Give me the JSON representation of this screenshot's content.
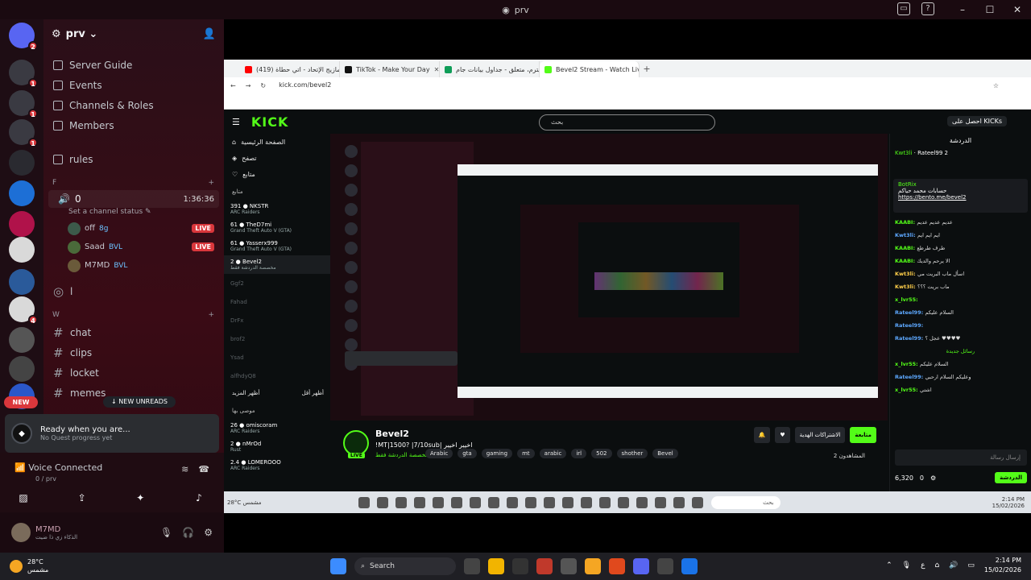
{
  "window": {
    "title": "prv"
  },
  "rail": {
    "servers": [
      {
        "icon": "discord-icon",
        "badge": "2",
        "color": "#5865f2"
      },
      {
        "icon": "server-icon",
        "badge": "1",
        "color": "#3a3a42"
      },
      {
        "icon": "server-icon",
        "badge": "1",
        "color": "#3a3a42"
      },
      {
        "icon": "server-icon",
        "badge": "1",
        "color": "#3a3a42"
      },
      {
        "icon": "server-icon",
        "badge": "",
        "color": "#2a2a30"
      },
      {
        "icon": "server-icon",
        "badge": "",
        "color": "#1d6fd6"
      },
      {
        "icon": "server-icon",
        "badge": "",
        "color": "#b0124a"
      },
      {
        "icon": "server-icon",
        "badge": "",
        "color": "#d9d9d9"
      },
      {
        "icon": "server-icon",
        "badge": "",
        "color": "#2a5a9a"
      },
      {
        "icon": "server-icon",
        "badge": "4",
        "color": "#d9d9d9"
      },
      {
        "icon": "server-icon",
        "badge": "",
        "color": "#555"
      },
      {
        "icon": "server-icon",
        "badge": "",
        "color": "#444"
      },
      {
        "icon": "server-icon",
        "badge": "",
        "color": "#2b57c9"
      }
    ],
    "new_label": "NEW"
  },
  "sidebar": {
    "server_name": "prv",
    "nav": [
      "Server Guide",
      "Events",
      "Channels & Roles",
      "Members"
    ],
    "rules": "rules",
    "cat_f": "F",
    "voice_channel": {
      "name": "0",
      "time": "1:36:36",
      "status": "Set a channel status"
    },
    "voice_users": [
      {
        "name": "off",
        "tag": "8g",
        "live": "LIVE"
      },
      {
        "name": "Saad",
        "tag": "BVL",
        "live": "LIVE"
      },
      {
        "name": "M7MD",
        "tag": "BVL",
        "live": ""
      }
    ],
    "voice_channel_2": "l",
    "cat_w": "W",
    "channels": [
      "chat",
      "clips",
      "locket",
      "memes"
    ],
    "new_unreads": "NEW UNREADS",
    "quest": {
      "title": "Ready when you are...",
      "sub": "No Quest progress yet"
    },
    "voice": {
      "status": "Voice Connected",
      "channel": "0 / prv"
    },
    "user": {
      "name": "M7MD",
      "status": "الذكاء زي ذا ضيت"
    }
  },
  "browser": {
    "tabs": [
      {
        "title": "(419) امازيج الإتحاد - اتي حطاة",
        "color": "#ff0000"
      },
      {
        "title": "TikTok - Make Your Day",
        "color": "#111"
      },
      {
        "title": "السيترم، متعلق - جداول بيانات جام",
        "color": "#0f9d58"
      },
      {
        "title": "Bevel2 Stream - Watch Live on",
        "color": "#53fc18"
      }
    ],
    "url": "kick.com/bevel2"
  },
  "kick": {
    "logo": "KICK",
    "search_placeholder": "بحث",
    "signup": "احصل على KICKs",
    "nav": [
      "الصفحة الرئيسية",
      "تصفح",
      "متابع"
    ],
    "section_following": "متابع",
    "streamers": [
      {
        "name": "391 ● NKSTR",
        "game": "ARC Raiders"
      },
      {
        "name": "61 ● TheD7mi",
        "game": "Grand Theft Auto V (GTA)"
      },
      {
        "name": "61 ● Yasserx999",
        "game": "Grand Theft Auto V (GTA)"
      },
      {
        "name": "2 ● Bevel2",
        "game": "مخصصة الدردشة فقط"
      }
    ],
    "offline": [
      "Ggf2",
      "Fahad",
      "DrFx",
      "brof2",
      "Ysad",
      "alfhdyQ8"
    ],
    "show_more": "أظهر المزيد",
    "show_less": "أظهر أقل",
    "section_recommended": "موصى بها",
    "recommended": [
      {
        "name": "26 ● omiscoram",
        "game": "ARC Raiders"
      },
      {
        "name": "2 ● nMrOd",
        "game": "Rust"
      },
      {
        "name": "2.4 ● LOMEROOO",
        "game": "ARC Raiders"
      }
    ],
    "stream": {
      "name": "Bevel2",
      "title": "!MT|1500? |7/10sub| اخيير اخيير",
      "category": "مخصصة الدردشة فقط",
      "tags": [
        "Arabic",
        "gta",
        "gaming",
        "mt",
        "arabic",
        "irl",
        "502",
        "shother",
        "Bevel"
      ],
      "live": "LIVE",
      "follow": "متابعة",
      "subscribe": "الاشتراكات الهدية",
      "viewers": "المشاهدون 2"
    },
    "chat": {
      "title": "الدردشة",
      "pinned_user": "Rateel99",
      "pinned_count": "2",
      "pinned_user2": "Kwt3li",
      "bot": "BotRix",
      "bot_text": "حسابات محمد حياكم",
      "bot_link": "https://bento.me/bevel2",
      "messages": [
        {
          "user": "KAABI",
          "text": "عديم عديم عديم",
          "c": "u"
        },
        {
          "user": "Kwt3li",
          "text": "ايم ايم ايم",
          "c": "u2"
        },
        {
          "user": "KAABI",
          "text": "طرف طرطع",
          "c": "u"
        },
        {
          "user": "KAABI",
          "text": "الا يرحم والديك",
          "c": "u"
        },
        {
          "user": "Kwt3li",
          "text": "اسأل ماب البريت مي",
          "c": "u3"
        },
        {
          "user": "Kwt3li",
          "text": "ماب بريت ؟؟؟",
          "c": "u3"
        },
        {
          "user": "x_lvr55",
          "text": "",
          "c": "u"
        },
        {
          "user": "Rateel99",
          "text": "السلام عليكم",
          "c": "u2"
        },
        {
          "user": "Rateel99",
          "text": "",
          "c": "u2"
        },
        {
          "user": "Rateel99",
          "text": "عجل ؟ ♥♥♥♥",
          "c": "u2"
        },
        {
          "user": "x_lvr55",
          "text": "السلام عليكم",
          "c": "u"
        },
        {
          "user": "Rateel99",
          "text": "وعليكم السلام ارحبي",
          "c": "u2"
        },
        {
          "user": "x_lvr55",
          "text": "اشتي",
          "c": "u"
        }
      ],
      "new_label": "رسائل جديدة",
      "input_placeholder": "إرسال رسالة",
      "points": "6,320",
      "count": "0",
      "send": "الدردشة"
    },
    "inner_taskbar": {
      "weather": "28°C مشمس",
      "search": "بحث",
      "time": "2:14 PM",
      "date": "15/02/2026"
    }
  },
  "taskbar": {
    "temp": "28°C",
    "cond": "مشمس",
    "search": "Search",
    "time": "2:14 PM",
    "date": "15/02/2026",
    "lang": "ع"
  }
}
